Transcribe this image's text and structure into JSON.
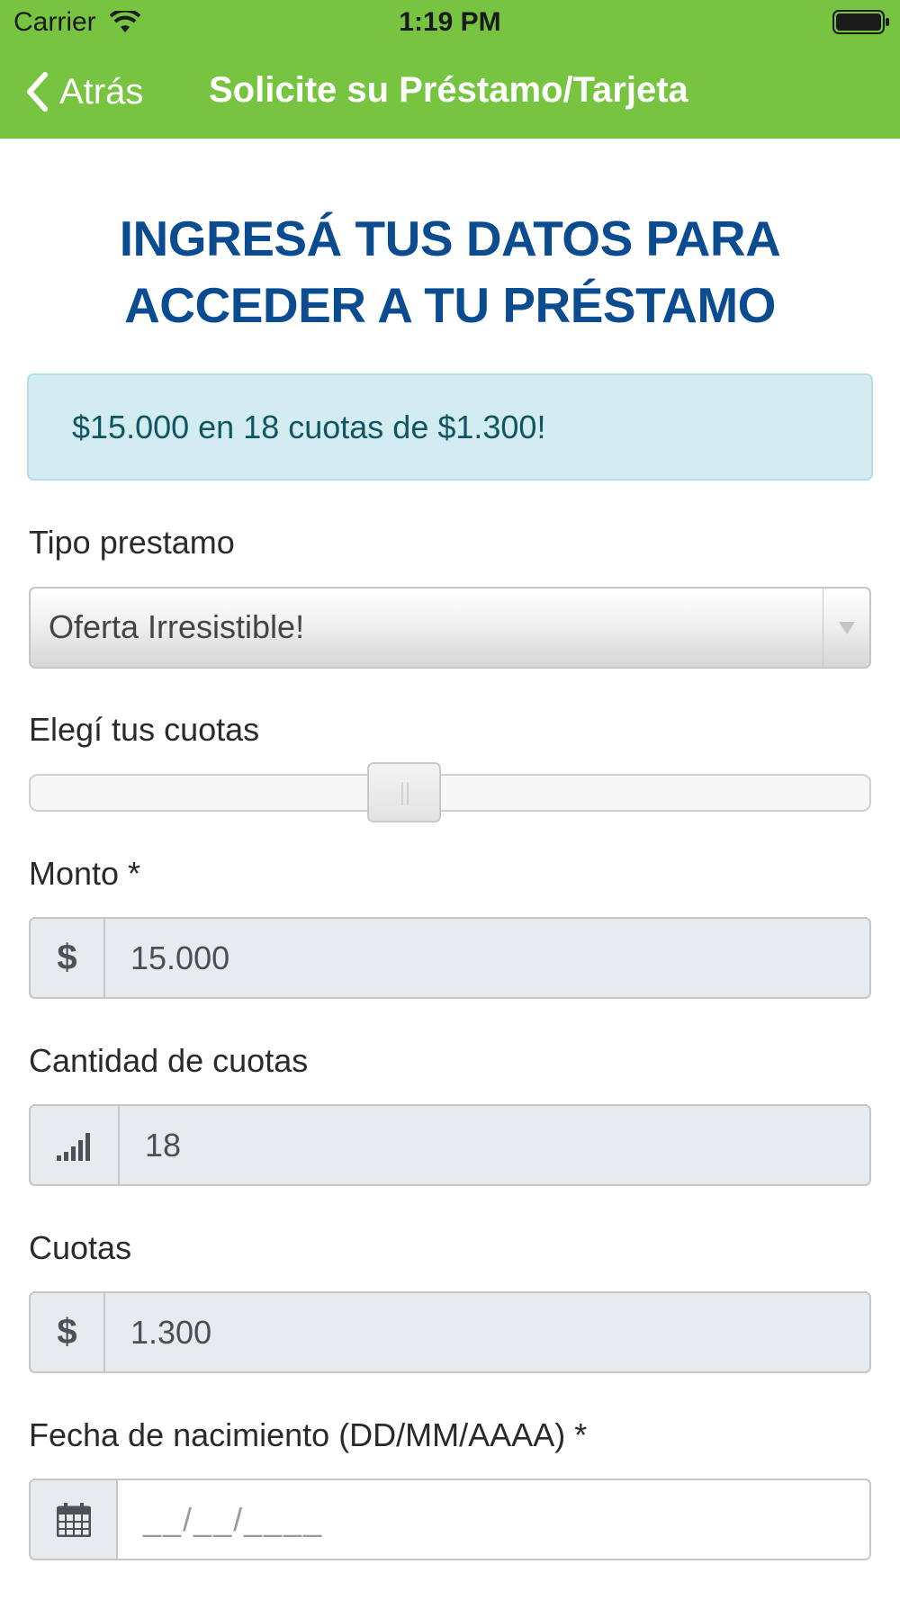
{
  "status_bar": {
    "carrier": "Carrier",
    "time": "1:19 PM"
  },
  "nav": {
    "back_label": "Atrás",
    "title": "Solicite su Préstamo/Tarjeta"
  },
  "heading": "INGRESÁ TUS DATOS PARA ACCEDER A TU PRÉSTAMO",
  "alert": "$15.000 en 18 cuotas de $1.300!",
  "form": {
    "tipo_prestamo": {
      "label": "Tipo prestamo",
      "selected": "Oferta Irresistible!"
    },
    "cuotas_slider": {
      "label": "Elegí tus cuotas",
      "value_fraction": 0.44
    },
    "monto": {
      "label": "Monto *",
      "addon": "$",
      "value": "15.000"
    },
    "cantidad_cuotas": {
      "label": "Cantidad de cuotas",
      "addon_icon": "signal-bars-icon",
      "value": "18"
    },
    "cuotas": {
      "label": "Cuotas",
      "addon": "$",
      "value": "1.300"
    },
    "fecha_nacimiento": {
      "label": "Fecha de nacimiento (DD/MM/AAAA) *",
      "addon_icon": "calendar-icon",
      "placeholder": "__/__/____"
    }
  },
  "colors": {
    "nav_bar": "#77c441",
    "heading": "#0b4b90",
    "alert_bg": "#d3ecf1",
    "alert_text": "#0f5562",
    "readonly_field_bg": "#e8ebee"
  }
}
